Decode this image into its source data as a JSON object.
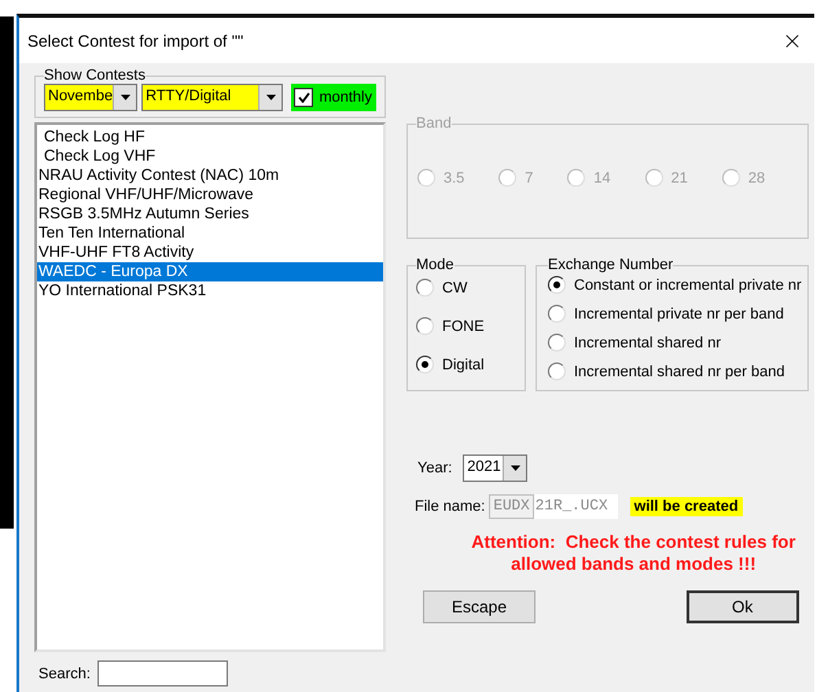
{
  "window": {
    "title": "Select Contest for import of \"\""
  },
  "show_contests": {
    "label": "Show Contests",
    "month": "Novembe",
    "category": "RTTY/Digital",
    "monthly": {
      "label": "monthly",
      "checked": true
    }
  },
  "contests": [
    {
      "name": "Check Log HF",
      "kind": "check",
      "selected": false
    },
    {
      "name": "Check Log VHF",
      "kind": "check",
      "selected": false
    },
    {
      "name": "NRAU Activity Contest (NAC) 10m",
      "kind": "contest",
      "selected": false
    },
    {
      "name": "Regional VHF/UHF/Microwave",
      "kind": "contest",
      "selected": false
    },
    {
      "name": "RSGB 3.5MHz Autumn Series",
      "kind": "contest",
      "selected": false
    },
    {
      "name": "Ten Ten International",
      "kind": "contest",
      "selected": false
    },
    {
      "name": "VHF-UHF FT8 Activity",
      "kind": "contest",
      "selected": false
    },
    {
      "name": "WAEDC - Europa DX",
      "kind": "contest",
      "selected": true
    },
    {
      "name": "YO International PSK31",
      "kind": "contest",
      "selected": false
    }
  ],
  "search": {
    "label": "Search:"
  },
  "band": {
    "label": "Band",
    "disabled": true,
    "options": [
      {
        "label": "3.5",
        "selected": false
      },
      {
        "label": "7",
        "selected": false
      },
      {
        "label": "14",
        "selected": false
      },
      {
        "label": "21",
        "selected": false
      },
      {
        "label": "28",
        "selected": false
      }
    ]
  },
  "mode": {
    "label": "Mode",
    "options": [
      {
        "label": "CW",
        "selected": false
      },
      {
        "label": "FONE",
        "selected": false
      },
      {
        "label": "Digital",
        "selected": true
      }
    ]
  },
  "exchange": {
    "label": "Exchange Number",
    "options": [
      {
        "label": "Constant or incremental private nr",
        "selected": true
      },
      {
        "label": "Incremental private nr per band",
        "selected": false
      },
      {
        "label": "Incremental shared nr",
        "selected": false
      },
      {
        "label": "Incremental shared nr per band",
        "selected": false
      }
    ]
  },
  "year": {
    "label": "Year:",
    "value": "2021"
  },
  "file": {
    "label": "File name:",
    "prefix": "EUDX",
    "name": "21R_.UCX",
    "note": "will be created"
  },
  "attention": "Attention:  Check the contest rules for\nallowed bands and modes !!!",
  "buttons": [
    {
      "label": "Escape",
      "default": false
    },
    {
      "label": "Ok",
      "default": true
    }
  ]
}
